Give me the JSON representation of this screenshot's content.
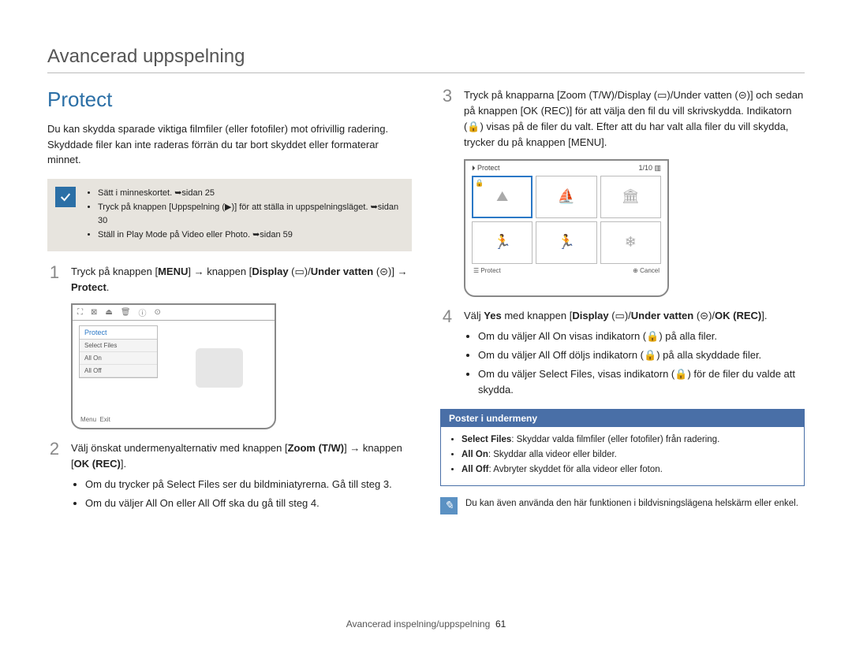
{
  "breadcrumb": "Avancerad uppspelning",
  "section_title": "Protect",
  "intro": "Du kan skydda sparade viktiga filmfiler (eller fotofiler) mot ofrivillig radering. Skyddade filer kan inte raderas förrän du tar bort skyddet eller formaterar minnet.",
  "notebox": {
    "items": [
      "Sätt i minneskortet. ➥sidan 25",
      "Tryck på knappen [Uppspelning (▶)] för att ställa in uppspelningsläget. ➥sidan 30",
      "Ställ in Play Mode på Video eller Photo. ➥sidan 59"
    ]
  },
  "left": {
    "step1": {
      "num": "1",
      "text_a": "Tryck på knappen [",
      "menu": "MENU",
      "text_b": "] → knappen [",
      "disp": "Display",
      "text_c": " (▭)/",
      "under": "Under vatten",
      "text_d": " (⊝)] → ",
      "protect": "Protect",
      "text_e": "."
    },
    "lcd_menu": {
      "topbar_icons": [
        "⛶",
        "⊠",
        "⏏",
        "🗑",
        "ⓘ",
        "⊙"
      ],
      "panel_header": "Protect",
      "rows": [
        "Select Files",
        "All On",
        "All Off"
      ],
      "footer_menu": "Menu",
      "footer_exit": "Exit"
    },
    "step2": {
      "num": "2",
      "text_a": "Välj önskat undermenyalternativ med knappen [",
      "zoom": "Zoom (T/W)",
      "text_b": "] → knappen [",
      "okrec": "OK (REC)",
      "text_c": "].",
      "bullets": [
        "Om du trycker på Select Files ser du bildminiatyrerna. Gå till steg 3.",
        "Om du väljer All On eller All Off ska du gå till steg 4."
      ]
    }
  },
  "right": {
    "step3": {
      "num": "3",
      "text": "Tryck på knapparna [Zoom (T/W)/Display (▭)/Under vatten (⊝)] och sedan på knappen [OK (REC)] för att välja den fil du vill skrivskydda. Indikatorn (🔒) visas på de filer du valt. Efter att du har valt alla filer du vill skydda, trycker du på knappen [MENU]."
    },
    "lcd_thumbs": {
      "title": "Protect",
      "counter": "1/10",
      "battery": "▥",
      "thumbs": [
        "⛰",
        "⛵",
        "🏛",
        "🏃",
        "🏃",
        "❄"
      ],
      "bottom_protect": "Protect",
      "bottom_cancel": "Cancel"
    },
    "step4": {
      "num": "4",
      "text_a": "Välj ",
      "yes": "Yes",
      "text_b": " med knappen [",
      "disp": "Display",
      "text_c": " (▭)/",
      "under": "Under vatten",
      "text_d": " (⊝)/",
      "okrec": "OK (REC)",
      "text_e": "].",
      "bullets": [
        "Om du väljer All On visas indikatorn (🔒) på alla filer.",
        "Om du väljer All Off döljs indikatorn (🔒) på alla skyddade filer.",
        "Om du väljer Select Files, visas indikatorn (🔒) för de filer du valde att skydda."
      ]
    },
    "submenu": {
      "header": "Poster i undermeny",
      "items": [
        {
          "k": "Select Files",
          "v": ": Skyddar valda filmfiler (eller fotofiler) från radering."
        },
        {
          "k": "All On",
          "v": ": Skyddar alla videor eller bilder."
        },
        {
          "k": "All Off",
          "v": ": Avbryter skyddet för alla videor eller foton."
        }
      ]
    },
    "footnote": "Du kan även använda den här funktionen i bildvisningslägena helskärm eller enkel."
  },
  "footer": {
    "section": "Avancerad inspelning/uppspelning",
    "page": "61"
  }
}
